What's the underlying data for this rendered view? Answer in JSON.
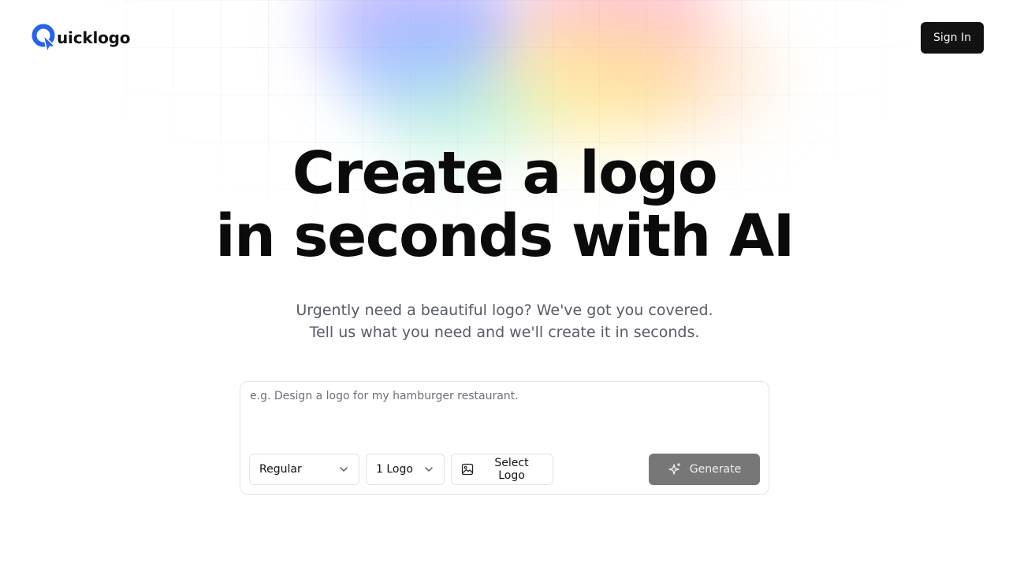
{
  "brand": {
    "name": "uicklogo",
    "logo_letter": "Q",
    "accent": "#2563eb"
  },
  "header": {
    "signin_label": "Sign In"
  },
  "hero": {
    "title_line1": "Create a logo",
    "title_line2": "in seconds with AI",
    "subtitle_line1": "Urgently need a beautiful logo? We've got you covered.",
    "subtitle_line2": "Tell us what you need and we'll create it in seconds."
  },
  "prompt": {
    "placeholder": "e.g. Design a logo for my hamburger restaurant.",
    "style_select": {
      "value": "Regular",
      "icon": "chevron-down-icon"
    },
    "count_select": {
      "value": "1 Logo",
      "icon": "chevron-down-icon"
    },
    "select_logo": {
      "label": "Select Logo",
      "icon": "image-icon"
    },
    "generate": {
      "label": "Generate",
      "icon": "sparkle-icon"
    }
  },
  "colors": {
    "primary_button": "#121212",
    "generate_button": "#777777",
    "subtitle_text": "#585c68"
  }
}
